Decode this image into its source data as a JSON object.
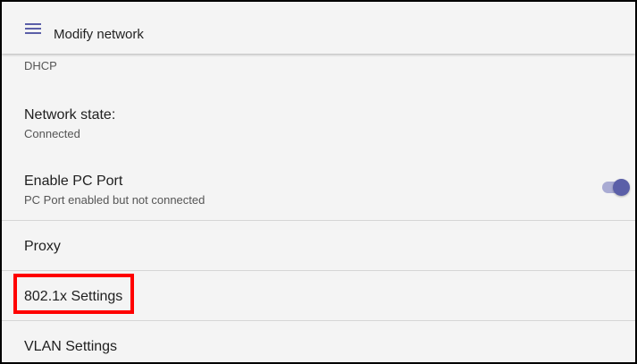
{
  "appbar": {
    "menu_icon": "hamburger-menu-icon",
    "title": "Modify network"
  },
  "settings": {
    "ip_mode_value": "DHCP",
    "network_state": {
      "label": "Network state:",
      "value": "Connected"
    },
    "pc_port": {
      "label": "Enable PC Port",
      "status": "PC Port enabled but not connected",
      "enabled": true
    },
    "proxy": {
      "label": "Proxy"
    },
    "dot1x": {
      "label": "802.1x Settings",
      "highlighted": true
    },
    "vlan": {
      "label": "VLAN Settings"
    }
  },
  "colors": {
    "accent": "#5b5fa8",
    "accent_light": "#a9abd3",
    "background": "#f4f4f4",
    "highlight_box": "#ff0000",
    "divider": "#d6d6d6"
  }
}
